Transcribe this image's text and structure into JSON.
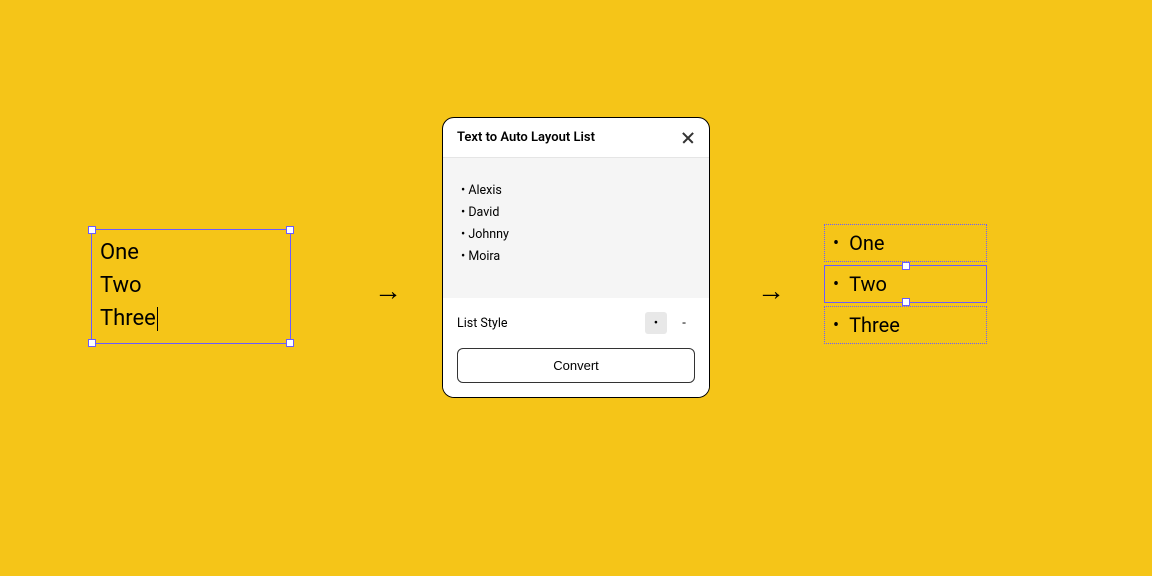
{
  "input": {
    "lines": [
      "One",
      "Two",
      "Three"
    ]
  },
  "dialog": {
    "title": "Text to Auto Layout List",
    "preview_items": [
      "Alexis",
      "David",
      "Johnny",
      "Moira"
    ],
    "list_style_label": "List Style",
    "style_bullet": "•",
    "style_dash": "-",
    "convert_label": "Convert"
  },
  "output": {
    "items": [
      "One",
      "Two",
      "Three"
    ],
    "selected_index": 1
  },
  "arrow_glyph": "→"
}
